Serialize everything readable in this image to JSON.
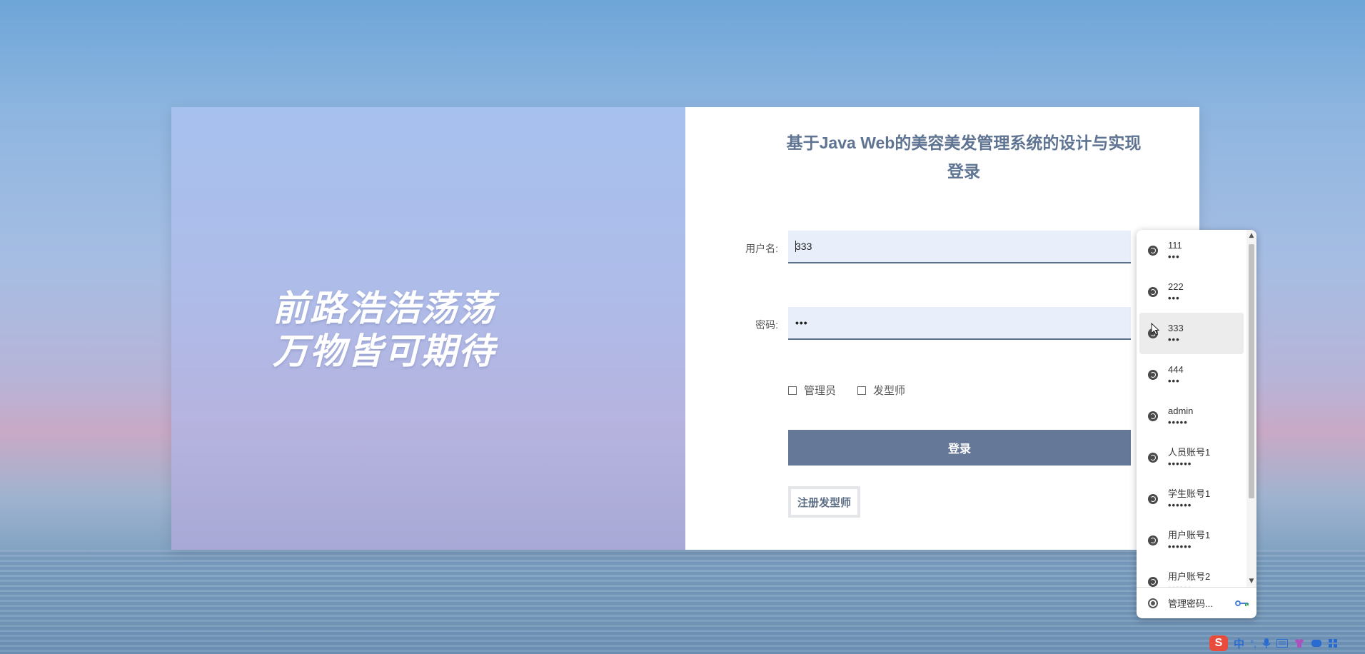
{
  "left_panel": {
    "slogan_line1": "前路浩浩荡荡",
    "slogan_line2": "万物皆可期待"
  },
  "login_form": {
    "title": "基于Java Web的美容美发管理系统的设计与实现登录",
    "username_label": "用户名:",
    "username_value": "333",
    "password_label": "密码:",
    "password_value": "•••",
    "roles": [
      {
        "label": "管理员",
        "checked": false
      },
      {
        "label": "发型师",
        "checked": false
      }
    ],
    "login_button": "登录",
    "register_button": "注册发型师"
  },
  "autofill_dropdown": {
    "items": [
      {
        "user": "111",
        "pass": "•••"
      },
      {
        "user": "222",
        "pass": "•••"
      },
      {
        "user": "333",
        "pass": "•••"
      },
      {
        "user": "444",
        "pass": "•••"
      },
      {
        "user": "admin",
        "pass": "•••••"
      },
      {
        "user": "人员账号1",
        "pass": "••••••"
      },
      {
        "user": "学生账号1",
        "pass": "••••••"
      },
      {
        "user": "用户账号1",
        "pass": "••••••"
      },
      {
        "user": "用户账号2",
        "pass": "••••••"
      }
    ],
    "highlighted_index": 2,
    "manage_label": "管理密码..."
  },
  "taskbar": {
    "ime_logo": "S",
    "ime_mode": "中",
    "ime_symbol": "°,"
  },
  "colors": {
    "accent": "#657898",
    "title": "#5e7492",
    "input_bg": "#e8effa",
    "ime_red": "#e94b3c",
    "ime_blue": "#2a6bd1"
  }
}
